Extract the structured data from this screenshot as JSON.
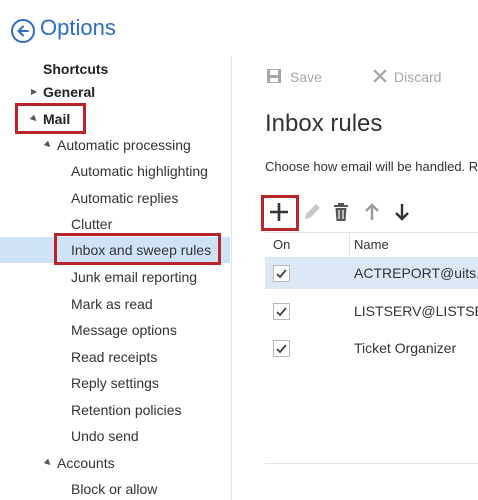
{
  "header": {
    "title": "Options"
  },
  "nav": {
    "shortcuts": "Shortcuts",
    "general": "General",
    "mail": "Mail",
    "automatic_processing": "Automatic processing",
    "automatic_processing_items": [
      "Automatic highlighting",
      "Automatic replies",
      "Clutter",
      "Inbox and sweep rules",
      "Junk email reporting",
      "Mark as read",
      "Message options",
      "Read receipts",
      "Reply settings",
      "Retention policies",
      "Undo send"
    ],
    "accounts": "Accounts",
    "accounts_items": [
      "Block or allow"
    ],
    "selected_item": "Inbox and sweep rules"
  },
  "toolbar": {
    "save_label": "Save",
    "discard_label": "Discard"
  },
  "page": {
    "title": "Inbox rules",
    "description": "Choose how email will be handled. R"
  },
  "rule_tools": {
    "icons": [
      "add-icon",
      "edit-icon",
      "delete-icon",
      "move-up-icon",
      "move-down-icon"
    ]
  },
  "rules_table": {
    "columns": [
      "On",
      "Name"
    ],
    "rows": [
      {
        "on": true,
        "name": "ACTREPORT@uits.u"
      },
      {
        "on": true,
        "name": "LISTSERV@LISTSER"
      },
      {
        "on": true,
        "name": "Ticket Organizer"
      }
    ]
  },
  "colors": {
    "accent": "#2b6cc4",
    "highlight_box": "#b8262a",
    "selected_nav": "#cfe3f7",
    "selected_row": "#dbe8f5"
  }
}
